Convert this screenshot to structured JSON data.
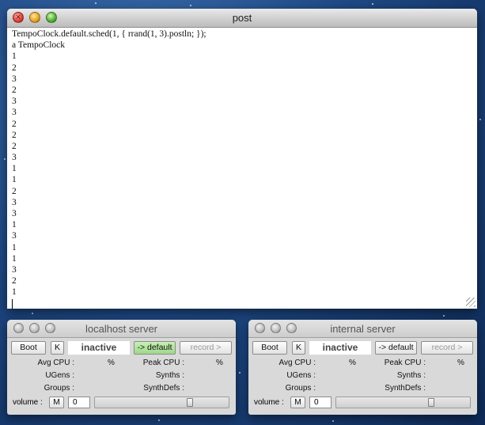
{
  "post_window": {
    "title": "post",
    "lines": [
      "TempoClock.default.sched(1, { rrand(1, 3).postln; });",
      "a TempoClock",
      "1",
      "2",
      "3",
      "2",
      "3",
      "3",
      "2",
      "2",
      "2",
      "3",
      "1",
      "1",
      "2",
      "3",
      "3",
      "1",
      "3",
      "1",
      "1",
      "3",
      "2",
      "1"
    ]
  },
  "servers": {
    "local": {
      "title": "localhost server",
      "boot_label": "Boot",
      "kill_label": "K",
      "status": "inactive",
      "default_label": "-> default",
      "default_active": true,
      "record_label": "record >",
      "avg_cpu_label": "Avg CPU :",
      "peak_cpu_label": "Peak CPU :",
      "percent": "%",
      "ugens_label": "UGens :",
      "synths_label": "Synths :",
      "groups_label": "Groups :",
      "synthdefs_label": "SynthDefs :",
      "volume_label": "volume :",
      "mute_label": "M",
      "volume_value": "0",
      "volume_slider_fraction": 0.74
    },
    "internal": {
      "title": "internal server",
      "boot_label": "Boot",
      "kill_label": "K",
      "status": "inactive",
      "default_label": "-> default",
      "default_active": false,
      "record_label": "record >",
      "avg_cpu_label": "Avg CPU :",
      "peak_cpu_label": "Peak CPU :",
      "percent": "%",
      "ugens_label": "UGens :",
      "synths_label": "Synths :",
      "groups_label": "Groups :",
      "synthdefs_label": "SynthDefs :",
      "volume_label": "volume :",
      "mute_label": "M",
      "volume_value": "0",
      "volume_slider_fraction": 0.74
    }
  },
  "colors": {
    "desktop": "#1f4a86",
    "default_active": "#9fd88a"
  }
}
